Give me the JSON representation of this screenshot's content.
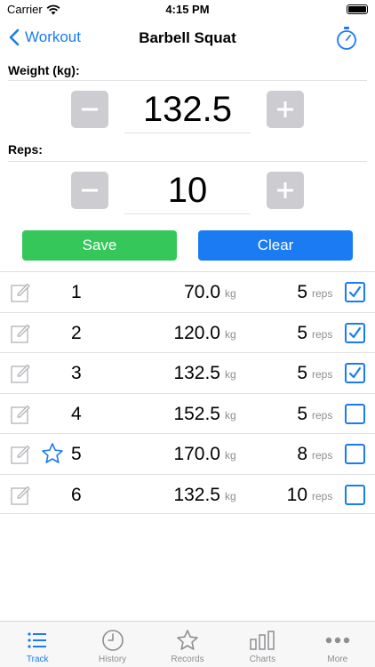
{
  "status_bar": {
    "carrier": "Carrier",
    "time": "4:15 PM"
  },
  "nav": {
    "back_label": "Workout",
    "title": "Barbell Squat",
    "timer_icon": "stopwatch-icon"
  },
  "weight": {
    "label": "Weight (kg):",
    "value": "132.5",
    "decrement_icon": "minus-icon",
    "increment_icon": "plus-icon"
  },
  "reps": {
    "label": "Reps:",
    "value": "10",
    "decrement_icon": "minus-icon",
    "increment_icon": "plus-icon"
  },
  "actions": {
    "save_label": "Save",
    "clear_label": "Clear"
  },
  "sets": [
    {
      "number": "1",
      "weight": "70.0",
      "weight_unit": "kg",
      "reps": "5",
      "reps_unit": "reps",
      "checked": true,
      "starred": false
    },
    {
      "number": "2",
      "weight": "120.0",
      "weight_unit": "kg",
      "reps": "5",
      "reps_unit": "reps",
      "checked": true,
      "starred": false
    },
    {
      "number": "3",
      "weight": "132.5",
      "weight_unit": "kg",
      "reps": "5",
      "reps_unit": "reps",
      "checked": true,
      "starred": false
    },
    {
      "number": "4",
      "weight": "152.5",
      "weight_unit": "kg",
      "reps": "5",
      "reps_unit": "reps",
      "checked": false,
      "starred": false
    },
    {
      "number": "5",
      "weight": "170.0",
      "weight_unit": "kg",
      "reps": "8",
      "reps_unit": "reps",
      "checked": false,
      "starred": true
    },
    {
      "number": "6",
      "weight": "132.5",
      "weight_unit": "kg",
      "reps": "10",
      "reps_unit": "reps",
      "checked": false,
      "starred": false
    }
  ],
  "tabs": [
    {
      "label": "Track",
      "icon": "list-icon",
      "active": true
    },
    {
      "label": "History",
      "icon": "clock-icon",
      "active": false
    },
    {
      "label": "Records",
      "icon": "star-icon",
      "active": false
    },
    {
      "label": "Charts",
      "icon": "bar-chart-icon",
      "active": false
    },
    {
      "label": "More",
      "icon": "ellipsis-icon",
      "active": false
    }
  ],
  "colors": {
    "accent": "#1a7bf2",
    "save": "#35c759",
    "stepper": "#cdcdd1",
    "muted": "#8e8e93"
  }
}
